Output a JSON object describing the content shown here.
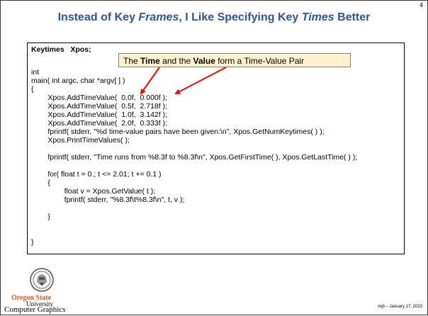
{
  "slide": {
    "number": "4",
    "title_parts": [
      "Instead of Key ",
      "Frames",
      ", I Like Specifying Key ",
      "Times",
      " Better"
    ],
    "callout_parts": [
      "The ",
      "Time",
      " and the ",
      "Value",
      " form a Time-Value Pair"
    ],
    "code_lines": [
      "Keytimes   Xpos;",
      "",
      "int",
      "main( int argc, char *argv[ ] )",
      "{",
      "        Xpos.AddTimeValue(  0.0f,  0.000f );",
      "        Xpos.AddTimeValue(  0.5f,  2.718f );",
      "        Xpos.AddTimeValue(  1.0f,  3.142f );",
      "        Xpos.AddTimeValue(  2.0f,  0.333f );",
      "        fprintf( stderr, \"%d time-value pairs have been given:\\n\", Xpos.GetNumKeytimes( ) );",
      "        Xpos.PrintTimeValues( );",
      "",
      "        fprintf( stderr, \"Time runs from %8.3f to %8.3f\\n\", Xpos.GetFirstTime( ), Xpos.GetLastTime( ) );",
      "",
      "        for( float t = 0.; t <= 2.01; t += 0.1 )",
      "        {",
      "                float v = Xpos.GetValue( t );",
      "                fprintf( stderr, \"%8.3f\\t%8.3f\\n\", t, v );",
      "        }",
      "}"
    ],
    "logo": {
      "icon": "oregon-state-beaver-logo",
      "line1": "Oregon State",
      "line2": "University"
    },
    "department": "Computer Graphics",
    "footer": "mjb – January 17, 2023",
    "colors": {
      "title": "#2f5597",
      "callout_bg": "#fff2cc",
      "arrow": "#ff0000",
      "logo_orange": "#d85b1b"
    }
  }
}
